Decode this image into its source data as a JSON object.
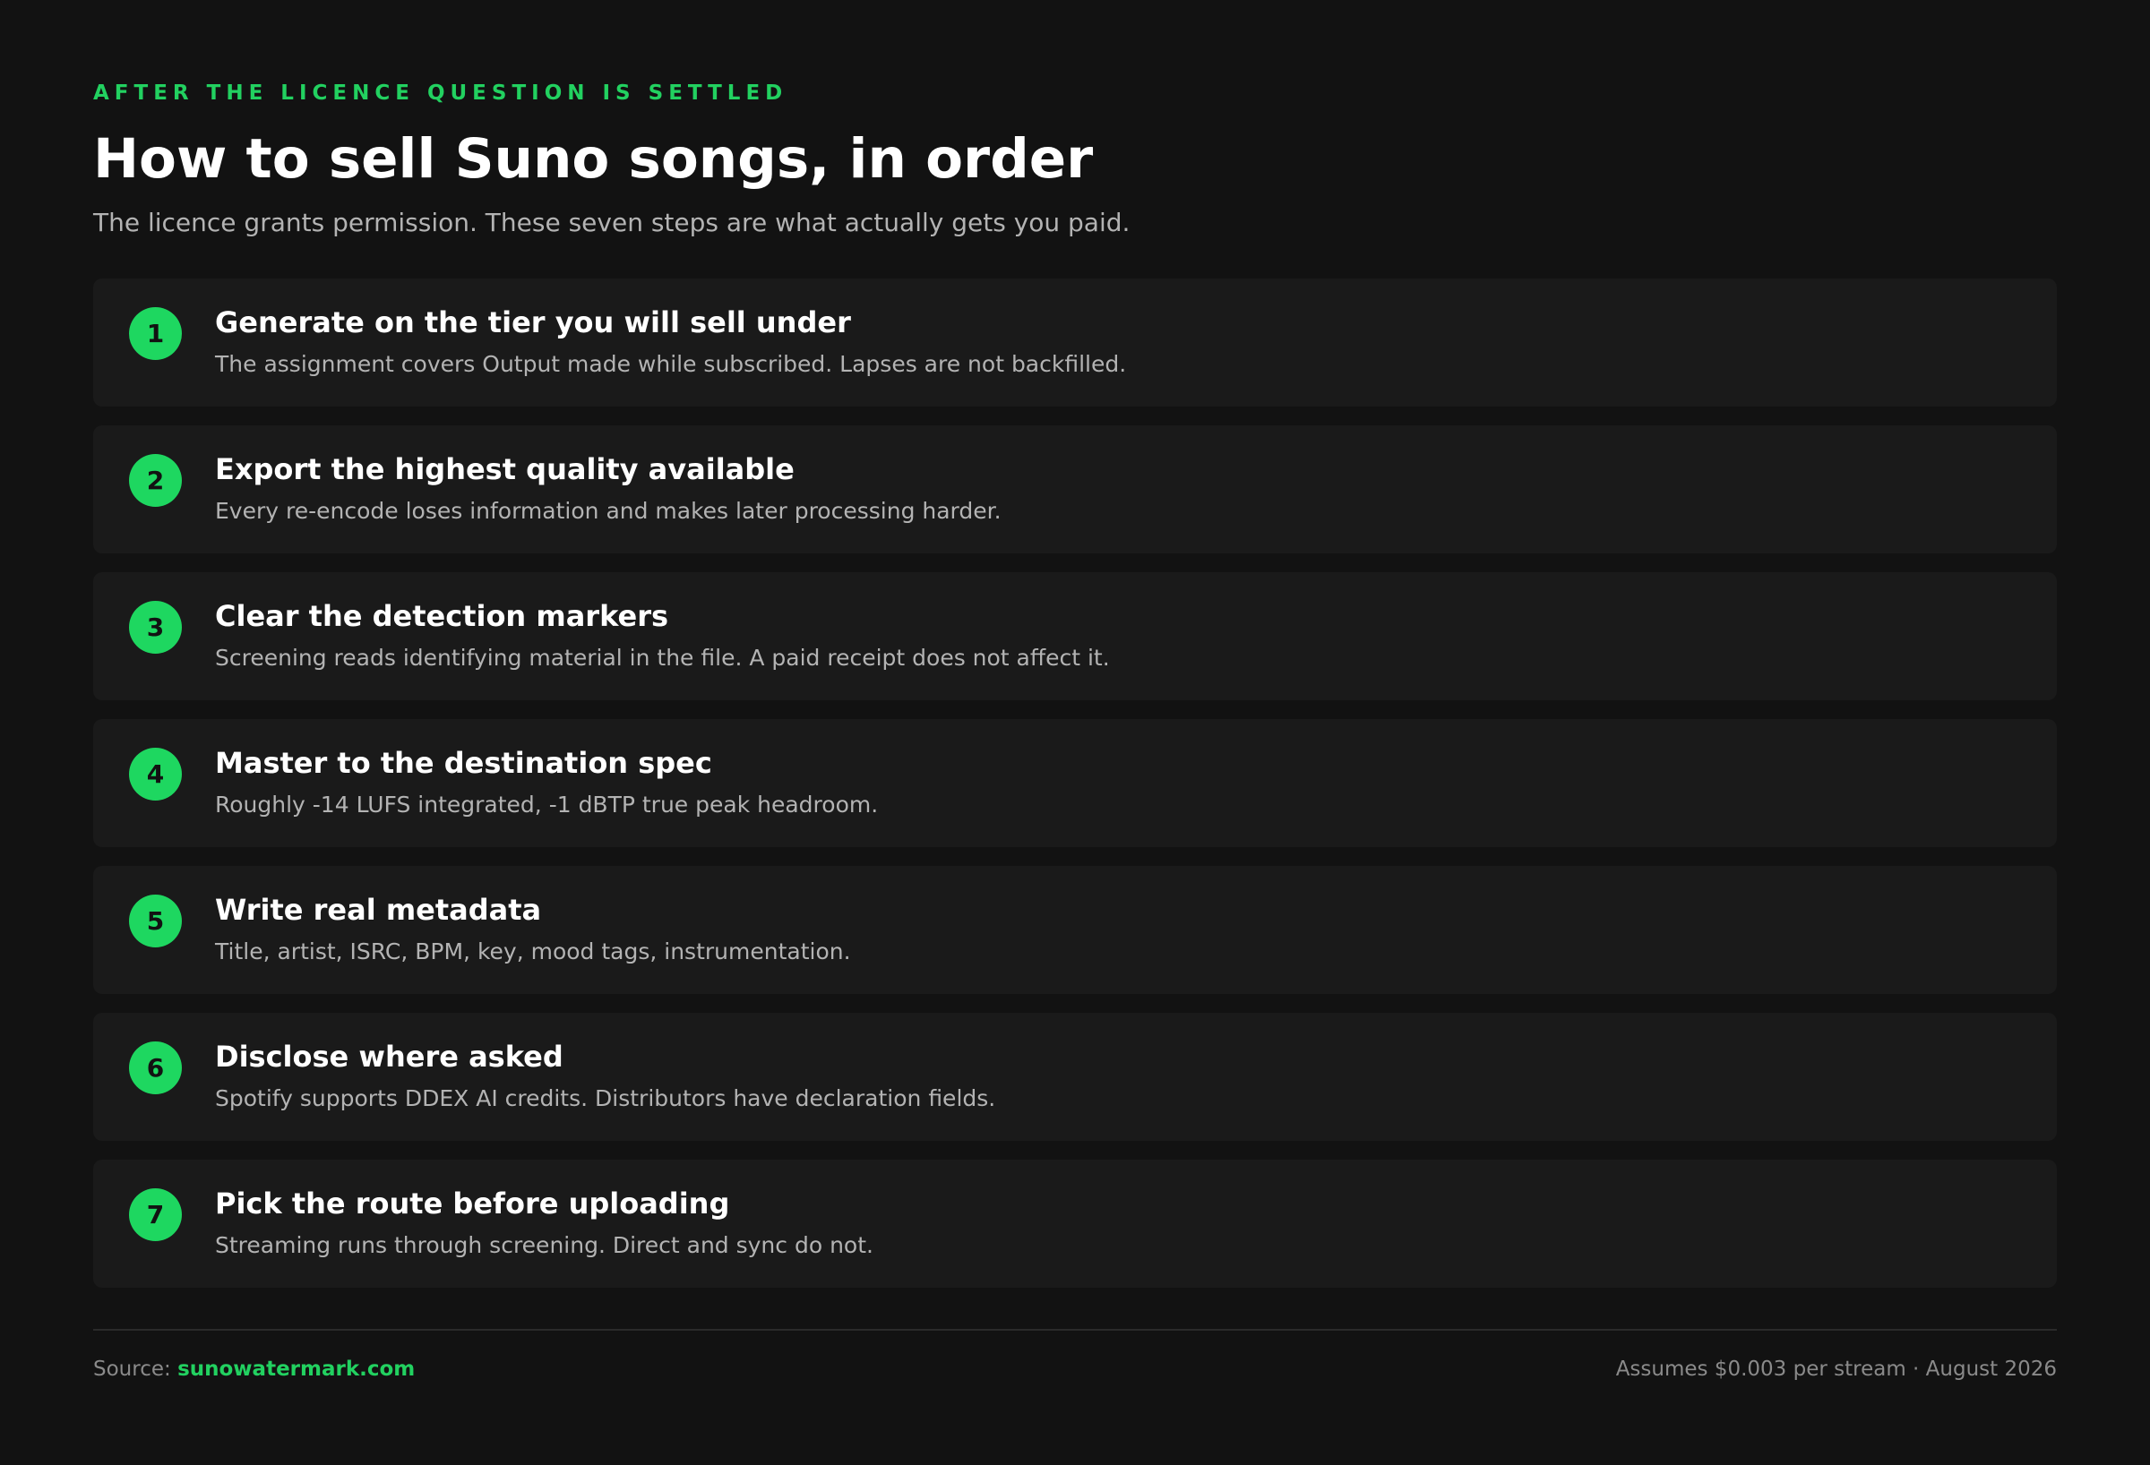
{
  "header": {
    "kicker": "AFTER THE LICENCE QUESTION IS SETTLED",
    "title": "How to sell Suno songs, in order",
    "subtitle": "The licence grants permission. These seven steps are what actually gets you paid."
  },
  "steps": [
    {
      "number": "1",
      "title": "Generate on the tier you will sell under",
      "description": "The assignment covers Output made while subscribed. Lapses are not backfilled."
    },
    {
      "number": "2",
      "title": "Export the highest quality available",
      "description": "Every re-encode loses information and makes later processing harder."
    },
    {
      "number": "3",
      "title": "Clear the detection markers",
      "description": "Screening reads identifying material in the file. A paid receipt does not affect it."
    },
    {
      "number": "4",
      "title": "Master to the destination spec",
      "description": "Roughly -14 LUFS integrated, -1 dBTP true peak headroom."
    },
    {
      "number": "5",
      "title": "Write real metadata",
      "description": "Title, artist, ISRC, BPM, key, mood tags, instrumentation."
    },
    {
      "number": "6",
      "title": "Disclose where asked",
      "description": "Spotify supports DDEX AI credits. Distributors have declaration fields."
    },
    {
      "number": "7",
      "title": "Pick the route before uploading",
      "description": "Streaming runs through screening. Direct and sync do not."
    }
  ],
  "footer": {
    "source_label": "Source:",
    "source_link": "sunowatermark.com",
    "note": "Assumes $0.003 per stream · August 2026"
  },
  "colors": {
    "background": "#121212",
    "card": "#1a1a1a",
    "accent": "#1ed760",
    "muted_text": "#b3b3b3"
  }
}
